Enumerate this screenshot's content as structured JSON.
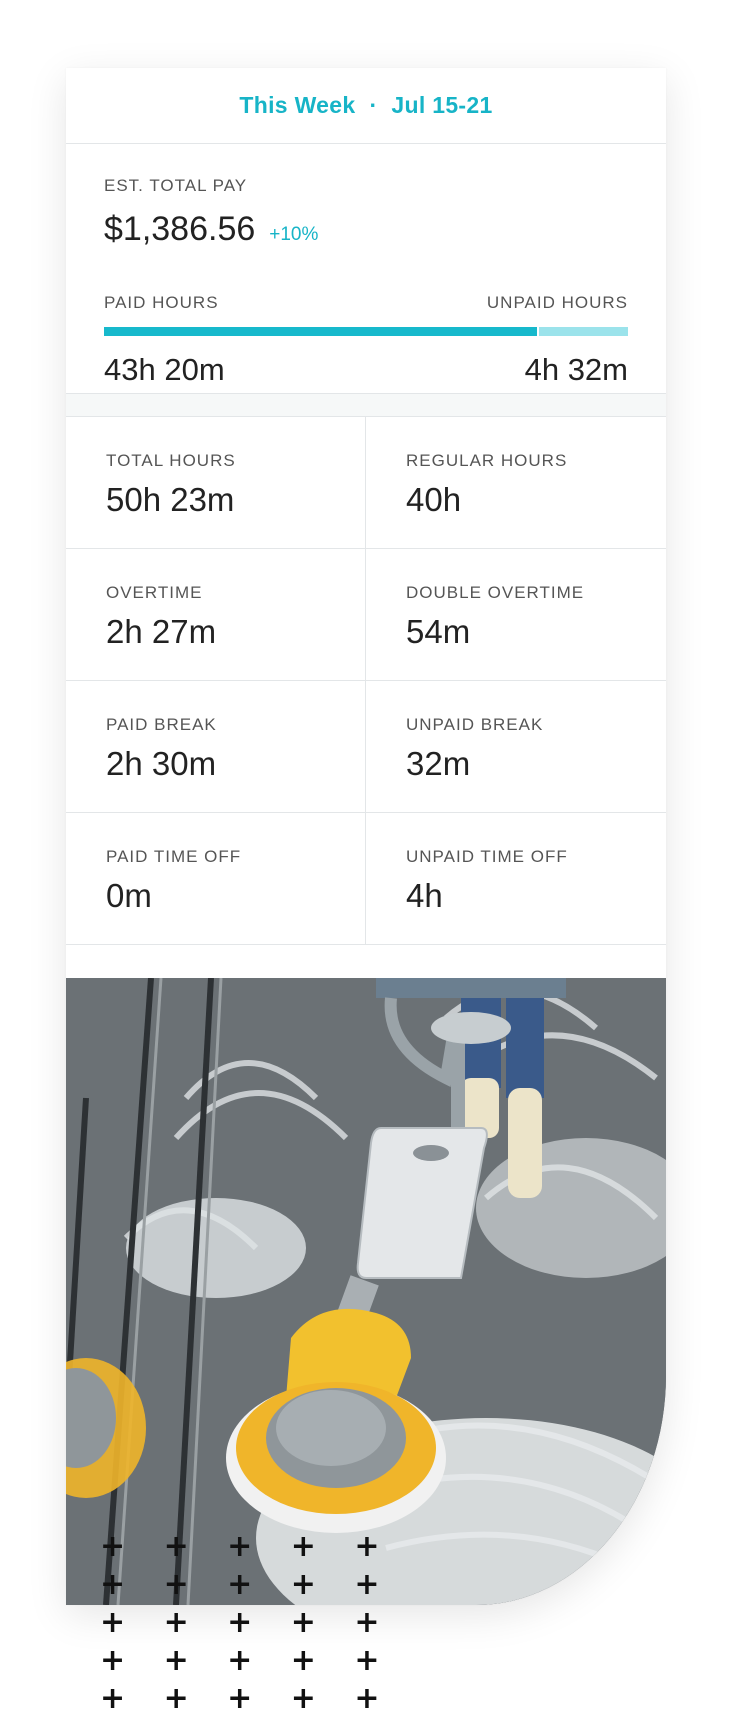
{
  "header": {
    "period": "This Week",
    "separator": "·",
    "dates": "Jul 15-21"
  },
  "pay": {
    "label": "EST. TOTAL PAY",
    "amount": "$1,386.56",
    "change": "+10%",
    "paid_label": "PAID HOURS",
    "unpaid_label": "UNPAID HOURS",
    "paid_value": "43h 20m",
    "unpaid_value": "4h 32m",
    "paid_fraction": 0.83
  },
  "stats": [
    {
      "label": "TOTAL HOURS",
      "value": "50h 23m"
    },
    {
      "label": "REGULAR HOURS",
      "value": "40h"
    },
    {
      "label": "OVERTIME",
      "value": "2h 27m"
    },
    {
      "label": "DOUBLE OVERTIME",
      "value": "54m"
    },
    {
      "label": "PAID BREAK",
      "value": "2h 30m"
    },
    {
      "label": "UNPAID BREAK",
      "value": "32m"
    },
    {
      "label": "PAID TIME OFF",
      "value": "0m"
    },
    {
      "label": "UNPAID TIME OFF",
      "value": "4h"
    }
  ],
  "colors": {
    "accent": "#17b4c7",
    "paid_bar": "#17b9cc",
    "unpaid_bar": "#9be3eb"
  },
  "image": {
    "subject": "floor-cleaning-machine-photo"
  }
}
